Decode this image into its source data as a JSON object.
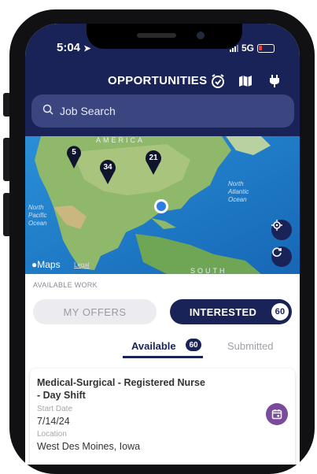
{
  "status_bar": {
    "time": "5:04",
    "network": "5G"
  },
  "header": {
    "title": "OPPORTUNITIES",
    "icons": [
      "alarm-clock-icon",
      "map-icon",
      "plug-icon"
    ]
  },
  "search": {
    "label": "Job Search"
  },
  "map": {
    "labels": {
      "america": "AMERICA",
      "north_pacific_line1": "North",
      "north_pacific_line2": "Pacific",
      "north_pacific_line3": "Ocean",
      "north_atlantic_line1": "North",
      "north_atlantic_line2": "Atlantic",
      "north_atlantic_line3": "Ocean",
      "south": "SOUTH"
    },
    "pins": [
      {
        "label": "5"
      },
      {
        "label": "34"
      },
      {
        "label": "21"
      }
    ],
    "attribution": "Maps",
    "legal": "Legal"
  },
  "section_label": "AVAILABLE WORK",
  "segments": {
    "offers_label": "MY OFFERS",
    "interested_label": "INTERESTED",
    "interested_count": "60"
  },
  "tabs": {
    "available_label": "Available",
    "available_count": "60",
    "submitted_label": "Submitted"
  },
  "job_card": {
    "title": "Medical-Surgical - Registered Nurse - Day Shift",
    "start_date_label": "Start Date",
    "start_date": "7/14/24",
    "location_label": "Location",
    "location": "West Des Moines, Iowa"
  },
  "colors": {
    "navy": "#1a2357",
    "search_bg": "#3b4580",
    "calendar_button": "#7a4b9a"
  }
}
